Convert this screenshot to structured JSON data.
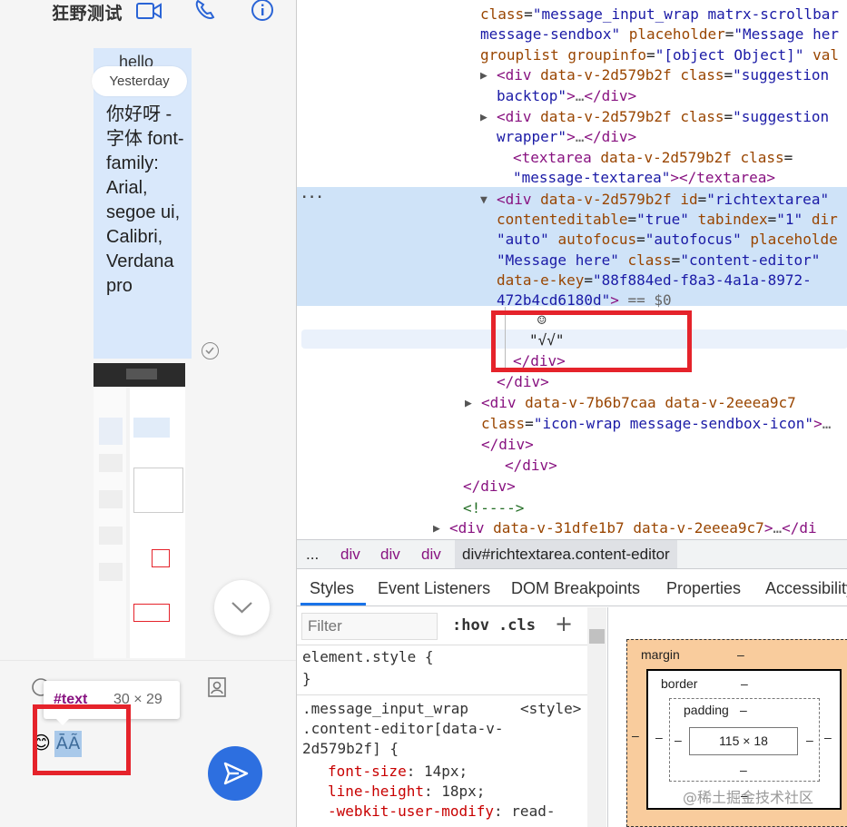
{
  "chat": {
    "title": "狂野测试",
    "partial_message": "hello",
    "date_pill": "Yesterday",
    "message_text": "你好呀 - 字体 font-family: Arial, segoe ui, Calibri, Verdana pro",
    "tooltip": {
      "tag": "#text",
      "size": "30 × 29"
    },
    "editor_content": "ĀÃ",
    "editor_emoji": "😊"
  },
  "devtools": {
    "dom_lines": [
      {
        "segments": [
          [
            "an",
            "class"
          ],
          [
            "tx",
            "="
          ],
          [
            "av",
            "\"message_input_wrap matrx-scrollbar"
          ]
        ]
      },
      {
        "segments": [
          [
            "av",
            "message-sendbox\""
          ],
          [
            "tx",
            " "
          ],
          [
            "an",
            "placeholder"
          ],
          [
            "tx",
            "="
          ],
          [
            "av",
            "\"Message her"
          ]
        ]
      },
      {
        "segments": [
          [
            "an",
            "grouplist"
          ],
          [
            "tx",
            " "
          ],
          [
            "an",
            "groupinfo"
          ],
          [
            "tx",
            "="
          ],
          [
            "av",
            "\"[object Object]\""
          ],
          [
            "tx",
            " "
          ],
          [
            "an",
            "val"
          ]
        ]
      },
      {
        "segments": [
          [
            "tg",
            "<div"
          ],
          [
            "tx",
            " "
          ],
          [
            "an",
            "data-v-2d579b2f"
          ],
          [
            "tx",
            " "
          ],
          [
            "an",
            "class"
          ],
          [
            "tx",
            "="
          ],
          [
            "av",
            "\"suggestion"
          ]
        ]
      },
      {
        "segments": [
          [
            "av",
            "backtop\""
          ],
          [
            "tg",
            ">"
          ],
          [
            "gr",
            "…"
          ],
          [
            "tg",
            "</div>"
          ]
        ]
      },
      {
        "segments": [
          [
            "tg",
            "<div"
          ],
          [
            "tx",
            " "
          ],
          [
            "an",
            "data-v-2d579b2f"
          ],
          [
            "tx",
            " "
          ],
          [
            "an",
            "class"
          ],
          [
            "tx",
            "="
          ],
          [
            "av",
            "\"suggestion"
          ]
        ]
      },
      {
        "segments": [
          [
            "av",
            "wrapper\""
          ],
          [
            "tg",
            ">"
          ],
          [
            "gr",
            "…"
          ],
          [
            "tg",
            "</div>"
          ]
        ]
      },
      {
        "segments": [
          [
            "tg",
            "<textarea"
          ],
          [
            "tx",
            " "
          ],
          [
            "an",
            "data-v-2d579b2f"
          ],
          [
            "tx",
            " "
          ],
          [
            "an",
            "class"
          ],
          [
            "tx",
            "="
          ]
        ]
      },
      {
        "segments": [
          [
            "av",
            "\"message-textarea\""
          ],
          [
            "tg",
            "></textarea>"
          ]
        ]
      },
      {
        "segments": [
          [
            "tg",
            "<div"
          ],
          [
            "tx",
            " "
          ],
          [
            "an",
            "data-v-2d579b2f"
          ],
          [
            "tx",
            " "
          ],
          [
            "an",
            "id"
          ],
          [
            "tx",
            "="
          ],
          [
            "av",
            "\"richtextarea\""
          ]
        ]
      },
      {
        "segments": [
          [
            "an",
            "contenteditable"
          ],
          [
            "tx",
            "="
          ],
          [
            "av",
            "\"true\""
          ],
          [
            "tx",
            " "
          ],
          [
            "an",
            "tabindex"
          ],
          [
            "tx",
            "="
          ],
          [
            "av",
            "\"1\""
          ],
          [
            "tx",
            " "
          ],
          [
            "an",
            "dir"
          ]
        ]
      },
      {
        "segments": [
          [
            "av",
            "\"auto\""
          ],
          [
            "tx",
            " "
          ],
          [
            "an",
            "autofocus"
          ],
          [
            "tx",
            "="
          ],
          [
            "av",
            "\"autofocus\""
          ],
          [
            "tx",
            " "
          ],
          [
            "an",
            "placeholde"
          ]
        ]
      },
      {
        "segments": [
          [
            "av",
            "\"Message here\""
          ],
          [
            "tx",
            " "
          ],
          [
            "an",
            "class"
          ],
          [
            "tx",
            "="
          ],
          [
            "av",
            "\"content-editor\""
          ]
        ]
      },
      {
        "segments": [
          [
            "an",
            "data-e-key"
          ],
          [
            "tx",
            "="
          ],
          [
            "av",
            "\"88f884ed-f8a3-4a1a-8972-"
          ]
        ]
      },
      {
        "segments": [
          [
            "av",
            "472b4cd6180d\""
          ],
          [
            "tg",
            ">"
          ],
          [
            "gr",
            " == $0"
          ]
        ]
      },
      {
        "segments": [
          [
            "tx",
            "☺"
          ]
        ]
      },
      {
        "segments": [
          [
            "tx",
            "\"√√\""
          ]
        ]
      },
      {
        "segments": [
          [
            "tg",
            "</div>"
          ]
        ]
      },
      {
        "segments": [
          [
            "tg",
            "</div>"
          ]
        ]
      },
      {
        "segments": [
          [
            "tg",
            "<div"
          ],
          [
            "tx",
            " "
          ],
          [
            "an",
            "data-v-7b6b7caa"
          ],
          [
            "tx",
            " "
          ],
          [
            "an",
            "data-v-2eeea9c7"
          ]
        ]
      },
      {
        "segments": [
          [
            "an",
            "class"
          ],
          [
            "tx",
            "="
          ],
          [
            "av",
            "\"icon-wrap message-sendbox-icon\""
          ],
          [
            "tg",
            ">"
          ],
          [
            "gr",
            "…"
          ]
        ]
      },
      {
        "segments": [
          [
            "tg",
            "</div>"
          ]
        ]
      },
      {
        "segments": [
          [
            "tg",
            "</div>"
          ]
        ]
      },
      {
        "segments": [
          [
            "tg",
            "</div>"
          ]
        ]
      },
      {
        "segments": [
          [
            "cm",
            "<!---->"
          ]
        ]
      },
      {
        "segments": [
          [
            "tg",
            "<div"
          ],
          [
            "tx",
            " "
          ],
          [
            "an",
            "data-v-31dfe1b7"
          ],
          [
            "tx",
            " "
          ],
          [
            "an",
            "data-v-2eeea9c7"
          ],
          [
            "tg",
            ">"
          ],
          [
            "gr",
            "…"
          ],
          [
            "tg",
            "</di"
          ]
        ]
      }
    ],
    "breadcrumb": [
      "...",
      "div",
      "div",
      "div",
      "div#richtextarea.content-editor"
    ],
    "tabs": [
      "Styles",
      "Event Listeners",
      "DOM Breakpoints",
      "Properties",
      "Accessibility"
    ],
    "styles": {
      "filter_placeholder": "Filter",
      "hov": ":hov",
      "cls": ".cls",
      "plus": "+",
      "element_style_open": "element.style {",
      "element_style_close": "}",
      "rule_selector_1": ".message_input_wrap",
      "rule_source": "<style>",
      "rule_selector_2": ".content-editor[data-v-",
      "rule_selector_3": "2d579b2f] {",
      "props": [
        {
          "name": "font-size",
          "value": "14px;"
        },
        {
          "name": "line-height",
          "value": "18px;"
        },
        {
          "name": "-webkit-user-modify",
          "value": "read-"
        }
      ]
    },
    "box_model": {
      "margin_label": "margin",
      "border_label": "border",
      "padding_label": "padding",
      "content_size": "115 × 18",
      "dash": "–"
    }
  },
  "watermark": "@稀土掘金技术社区",
  "colors": {
    "accent": "#2d6fe0",
    "highlight_box": "#e5232b",
    "selection": "#cfe3f8"
  }
}
